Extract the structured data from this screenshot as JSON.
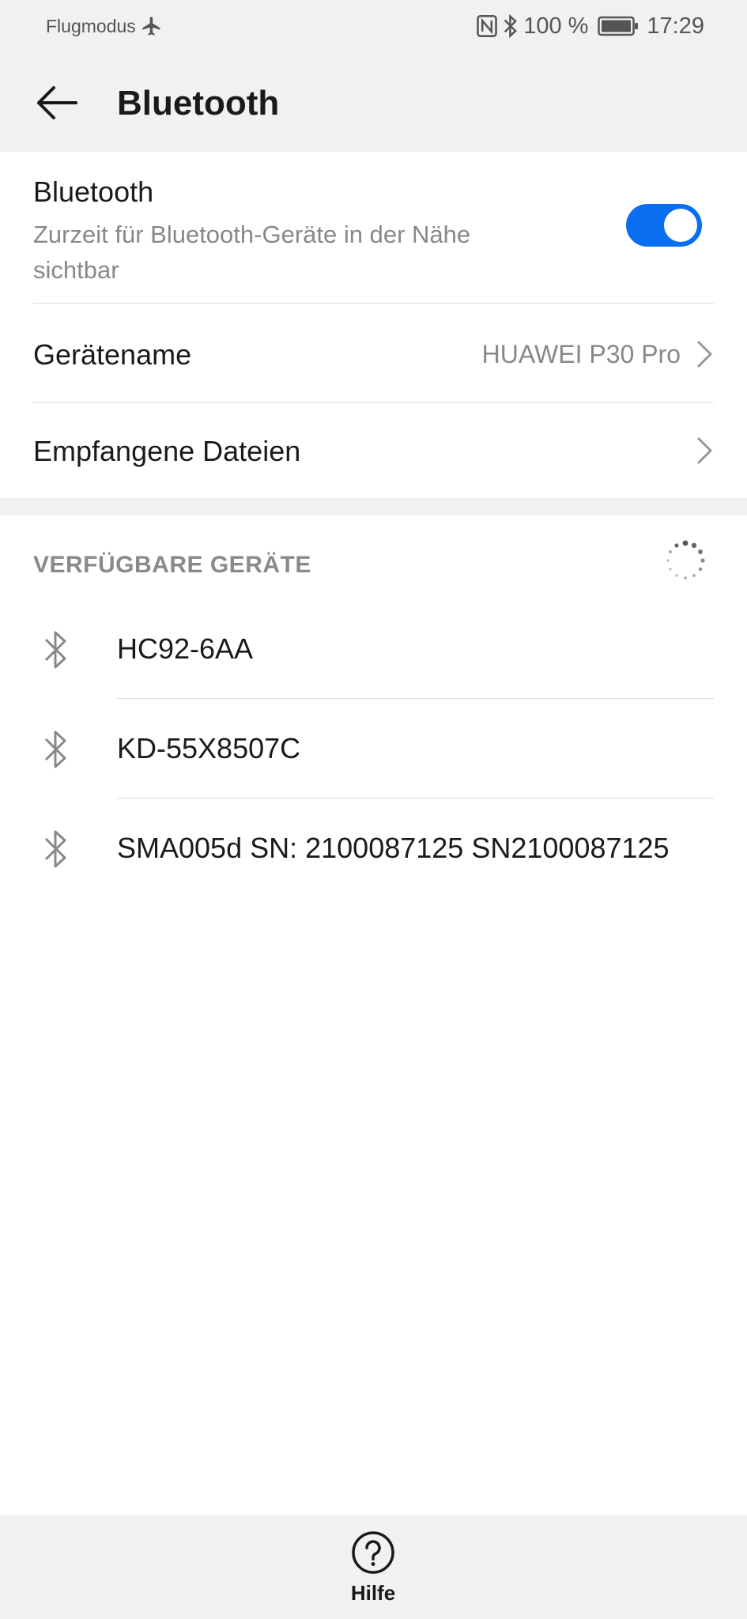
{
  "status_bar": {
    "airplane_label": "Flugmodus",
    "battery_text": "100 %",
    "time": "17:29"
  },
  "app_bar": {
    "title": "Bluetooth"
  },
  "bluetooth_toggle": {
    "title": "Bluetooth",
    "subtitle": "Zurzeit für Bluetooth-Geräte in der Nähe sichtbar",
    "enabled": true
  },
  "device_name_row": {
    "label": "Gerätename",
    "value": "HUAWEI P30 Pro"
  },
  "received_files_row": {
    "label": "Empfangene Dateien"
  },
  "available_devices": {
    "header": "VERFÜGBARE GERÄTE",
    "items": [
      {
        "name": "HC92-6AA"
      },
      {
        "name": "KD-55X8507C"
      },
      {
        "name": "SMA005d SN: 2100087125 SN2100087125"
      }
    ]
  },
  "bottom_bar": {
    "help_label": "Hilfe"
  },
  "colors": {
    "accent": "#0a6ef0",
    "background_gray": "#f1f1f1",
    "secondary_text": "#888888"
  }
}
